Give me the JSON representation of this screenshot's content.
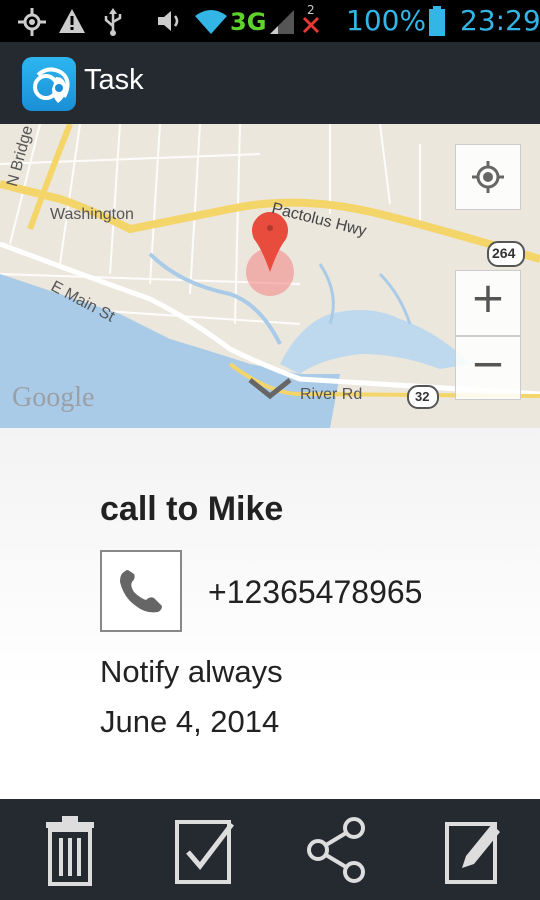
{
  "status_bar": {
    "network": "3G",
    "sim_indicator": "2",
    "battery": "100%",
    "time": "23:29",
    "icons": [
      "gps-icon",
      "warning-icon",
      "usb-icon",
      "volume-icon",
      "wifi-icon",
      "signal-icon",
      "no-sim-icon",
      "battery-icon"
    ]
  },
  "action_bar": {
    "title": "Task",
    "app_icon": "app-logo-icon"
  },
  "map": {
    "labels": {
      "street1": "N Bridge St",
      "town": "Washington",
      "highway": "Pactolus Hwy",
      "route_264": "264",
      "street2": "E Main St",
      "river_rd": "River Rd",
      "route_32": "32",
      "attribution": "Google"
    },
    "controls": {
      "locate": "my-location-icon",
      "zoom_in": "+",
      "zoom_out": "−"
    }
  },
  "task": {
    "title": "call to Mike",
    "phone": "+12365478965",
    "notify": "Notify always",
    "date": "June 4, 2014"
  },
  "bottom_bar": {
    "actions": [
      "delete",
      "complete",
      "share",
      "edit"
    ]
  },
  "colors": {
    "accent": "#33b5e5",
    "bar_bg": "#252a31",
    "pin": "#e74c3c"
  }
}
